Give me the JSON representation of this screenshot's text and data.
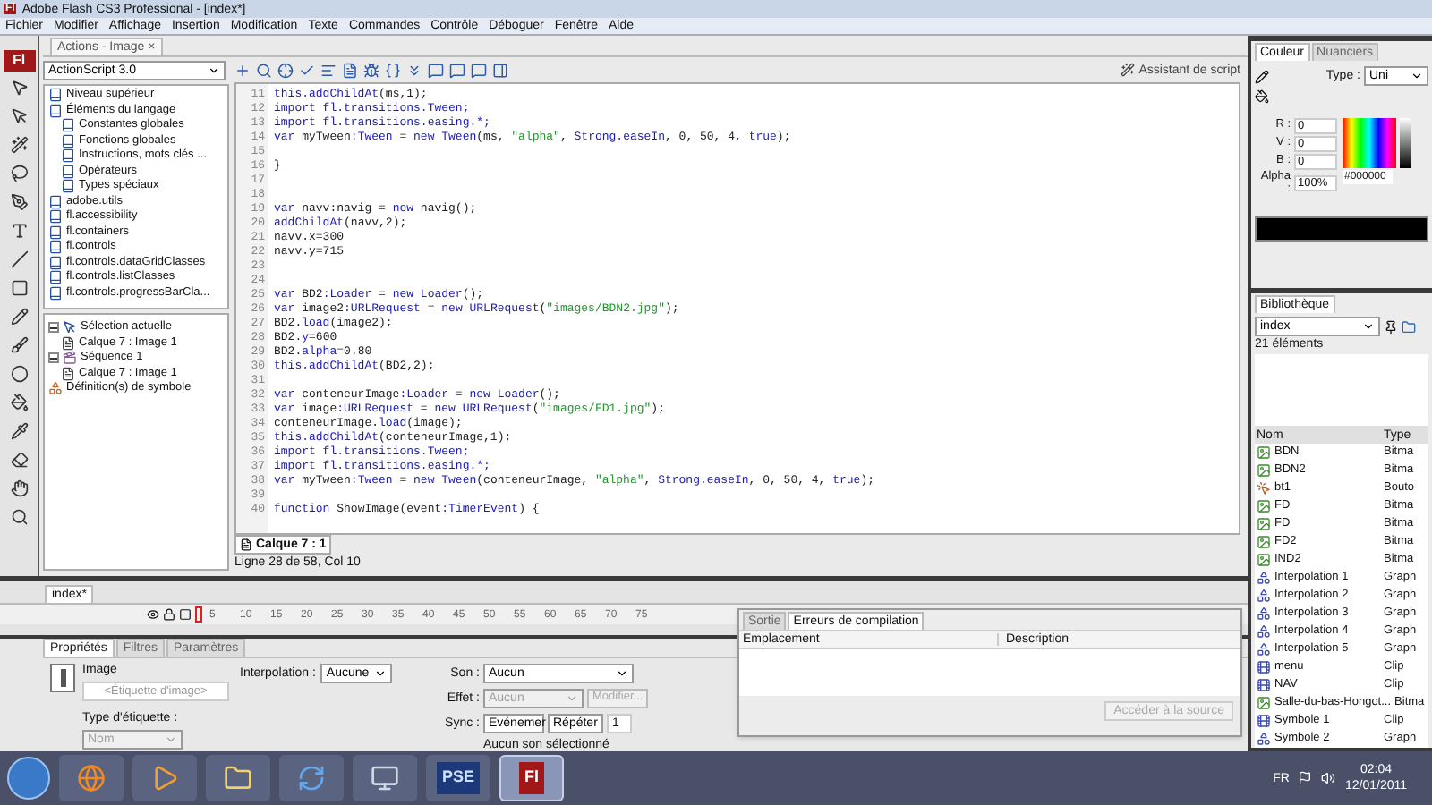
{
  "window": {
    "app_icon": "Fl",
    "title": "Adobe Flash CS3 Professional - [index*]"
  },
  "menu": [
    "Fichier",
    "Modifier",
    "Affichage",
    "Insertion",
    "Modification",
    "Texte",
    "Commandes",
    "Contrôle",
    "Déboguer",
    "Fenêtre",
    "Aide"
  ],
  "tools": {
    "logo": "Fl"
  },
  "actions_panel": {
    "tab": "Actions - Image",
    "close": "×",
    "language": "ActionScript 3.0",
    "toolbox_tree": [
      {
        "label": "Niveau supérieur",
        "kind": "book"
      },
      {
        "label": "Éléments du langage",
        "kind": "book",
        "children": [
          {
            "label": "Constantes globales",
            "kind": "book"
          },
          {
            "label": "Fonctions globales",
            "kind": "book"
          },
          {
            "label": "Instructions, mots clés ...",
            "kind": "book"
          },
          {
            "label": "Opérateurs",
            "kind": "book"
          },
          {
            "label": "Types spéciaux",
            "kind": "book"
          }
        ]
      },
      {
        "label": "adobe.utils",
        "kind": "book"
      },
      {
        "label": "fl.accessibility",
        "kind": "book"
      },
      {
        "label": "fl.containers",
        "kind": "book"
      },
      {
        "label": "fl.controls",
        "kind": "book"
      },
      {
        "label": "fl.controls.dataGridClasses",
        "kind": "book"
      },
      {
        "label": "fl.controls.listClasses",
        "kind": "book"
      },
      {
        "label": "fl.controls.progressBarCla...",
        "kind": "book"
      }
    ],
    "script_tree": [
      {
        "label": "Sélection actuelle",
        "kind": "selection",
        "expanded": true,
        "children": [
          {
            "label": "Calque 7 : Image 1",
            "kind": "layer"
          }
        ]
      },
      {
        "label": "Séquence 1",
        "kind": "scene",
        "expanded": true,
        "children": [
          {
            "label": "Calque 7 : Image 1",
            "kind": "layer"
          }
        ]
      },
      {
        "label": "Définition(s) de symbole",
        "kind": "symbols"
      }
    ],
    "assistant": "Assistant de script",
    "code_lines": [
      {
        "number": "11",
        "tokens": [
          {
            "text": "this.addChildAt",
            "kind": "kw"
          },
          {
            "text": "(ms,1);",
            "kind": "plain"
          }
        ]
      },
      {
        "number": "12",
        "tokens": [
          {
            "text": "import fl.transitions.Tween;",
            "kind": "kw"
          }
        ]
      },
      {
        "number": "13",
        "tokens": [
          {
            "text": "import fl.transitions.easing.*;",
            "kind": "kw"
          }
        ]
      },
      {
        "number": "14",
        "tokens": [
          {
            "text": "var",
            "kind": "kw"
          },
          {
            "text": " myTween",
            "kind": "plain"
          },
          {
            "text": ":Tween",
            "kind": "kw"
          },
          {
            "text": " = ",
            "kind": "plain"
          },
          {
            "text": "new Tween",
            "kind": "kw"
          },
          {
            "text": "(ms, ",
            "kind": "plain"
          },
          {
            "text": "\"alpha\"",
            "kind": "str"
          },
          {
            "text": ", ",
            "kind": "plain"
          },
          {
            "text": "Strong.easeIn",
            "kind": "kw"
          },
          {
            "text": ", 0, 50, 4, ",
            "kind": "plain"
          },
          {
            "text": "true",
            "kind": "kw"
          },
          {
            "text": ");",
            "kind": "plain"
          }
        ]
      },
      {
        "number": "15"
      },
      {
        "number": "16",
        "tokens": [
          {
            "text": "}",
            "kind": "plain"
          }
        ]
      },
      {
        "number": "17"
      },
      {
        "number": "18"
      },
      {
        "number": "19",
        "tokens": [
          {
            "text": "var",
            "kind": "kw"
          },
          {
            "text": " navv:navig = ",
            "kind": "plain"
          },
          {
            "text": "new",
            "kind": "kw"
          },
          {
            "text": " navig();",
            "kind": "plain"
          }
        ]
      },
      {
        "number": "20",
        "tokens": [
          {
            "text": "addChildAt",
            "kind": "kw"
          },
          {
            "text": "(navv,2);",
            "kind": "plain"
          }
        ]
      },
      {
        "number": "21",
        "tokens": [
          {
            "text": "navv.x=300",
            "kind": "plain"
          }
        ]
      },
      {
        "number": "22",
        "tokens": [
          {
            "text": "navv.y=715",
            "kind": "plain"
          }
        ]
      },
      {
        "number": "23"
      },
      {
        "number": "24"
      },
      {
        "number": "25",
        "tokens": [
          {
            "text": "var",
            "kind": "kw"
          },
          {
            "text": " BD2",
            "kind": "plain"
          },
          {
            "text": ":Loader",
            "kind": "kw"
          },
          {
            "text": " = ",
            "kind": "plain"
          },
          {
            "text": "new Loader",
            "kind": "kw"
          },
          {
            "text": "();",
            "kind": "plain"
          }
        ]
      },
      {
        "number": "26",
        "tokens": [
          {
            "text": "var",
            "kind": "kw"
          },
          {
            "text": " image2",
            "kind": "plain"
          },
          {
            "text": ":URLRequest",
            "kind": "kw"
          },
          {
            "text": " = ",
            "kind": "plain"
          },
          {
            "text": "new URLRequest",
            "kind": "kw"
          },
          {
            "text": "(",
            "kind": "plain"
          },
          {
            "text": "\"images/BDN2.jpg\"",
            "kind": "str"
          },
          {
            "text": ");",
            "kind": "plain"
          }
        ]
      },
      {
        "number": "27",
        "tokens": [
          {
            "text": "BD2.",
            "kind": "plain"
          },
          {
            "text": "load",
            "kind": "kw"
          },
          {
            "text": "(image2);",
            "kind": "plain"
          }
        ]
      },
      {
        "number": "28",
        "tokens": [
          {
            "text": "BD2.",
            "kind": "plain"
          },
          {
            "text": "y",
            "kind": "kw"
          },
          {
            "text": "=600",
            "kind": "plain"
          }
        ]
      },
      {
        "number": "29",
        "tokens": [
          {
            "text": "BD2.",
            "kind": "plain"
          },
          {
            "text": "alpha",
            "kind": "kw"
          },
          {
            "text": "=0.80",
            "kind": "plain"
          }
        ]
      },
      {
        "number": "30",
        "tokens": [
          {
            "text": "this.addChildAt",
            "kind": "kw"
          },
          {
            "text": "(BD2,2);",
            "kind": "plain"
          }
        ]
      },
      {
        "number": "31"
      },
      {
        "number": "32",
        "tokens": [
          {
            "text": "var",
            "kind": "kw"
          },
          {
            "text": " conteneurImage",
            "kind": "plain"
          },
          {
            "text": ":Loader",
            "kind": "kw"
          },
          {
            "text": " = ",
            "kind": "plain"
          },
          {
            "text": "new Loader",
            "kind": "kw"
          },
          {
            "text": "();",
            "kind": "plain"
          }
        ]
      },
      {
        "number": "33",
        "tokens": [
          {
            "text": "var",
            "kind": "kw"
          },
          {
            "text": " image",
            "kind": "plain"
          },
          {
            "text": ":URLRequest",
            "kind": "kw"
          },
          {
            "text": " = ",
            "kind": "plain"
          },
          {
            "text": "new URLRequest",
            "kind": "kw"
          },
          {
            "text": "(",
            "kind": "plain"
          },
          {
            "text": "\"images/FD1.jpg\"",
            "kind": "str"
          },
          {
            "text": ");",
            "kind": "plain"
          }
        ]
      },
      {
        "number": "34",
        "tokens": [
          {
            "text": "conteneurImage.",
            "kind": "plain"
          },
          {
            "text": "load",
            "kind": "kw"
          },
          {
            "text": "(image);",
            "kind": "plain"
          }
        ]
      },
      {
        "number": "35",
        "tokens": [
          {
            "text": "this.addChildAt",
            "kind": "kw"
          },
          {
            "text": "(conteneurImage,1);",
            "kind": "plain"
          }
        ]
      },
      {
        "number": "36",
        "tokens": [
          {
            "text": "import fl.transitions.Tween;",
            "kind": "kw"
          }
        ]
      },
      {
        "number": "37",
        "tokens": [
          {
            "text": "import fl.transitions.easing.*;",
            "kind": "kw"
          }
        ]
      },
      {
        "number": "38",
        "tokens": [
          {
            "text": "var",
            "kind": "kw"
          },
          {
            "text": " myTween",
            "kind": "plain"
          },
          {
            "text": ":Tween",
            "kind": "kw"
          },
          {
            "text": " = ",
            "kind": "plain"
          },
          {
            "text": "new Tween",
            "kind": "kw"
          },
          {
            "text": "(conteneurImage, ",
            "kind": "plain"
          },
          {
            "text": "\"alpha\"",
            "kind": "str"
          },
          {
            "text": ", ",
            "kind": "plain"
          },
          {
            "text": "Strong.easeIn",
            "kind": "kw"
          },
          {
            "text": ", 0, 50, 4, ",
            "kind": "plain"
          },
          {
            "text": "true",
            "kind": "kw"
          },
          {
            "text": ");",
            "kind": "plain"
          }
        ]
      },
      {
        "number": "39"
      },
      {
        "number": "40",
        "tokens": [
          {
            "text": "function",
            "kind": "kw"
          },
          {
            "text": " ShowImage(event",
            "kind": "plain"
          },
          {
            "text": ":TimerEvent",
            "kind": "kw"
          },
          {
            "text": ") {",
            "kind": "plain"
          }
        ]
      }
    ],
    "layer_tab": "Calque 7 : 1",
    "status": "Ligne 28 de 58, Col 10"
  },
  "color_panel": {
    "tabs": [
      {
        "label": "Couleur",
        "selected": true
      },
      {
        "label": "Nuanciers",
        "selected": false
      }
    ],
    "type_label": "Type :",
    "type_value": "Uni",
    "channels": [
      {
        "label": "R :",
        "value": "0"
      },
      {
        "label": "V :",
        "value": "0"
      },
      {
        "label": "B :",
        "value": "0"
      },
      {
        "label": "Alpha :",
        "value": "100%"
      }
    ],
    "hex": "#000000"
  },
  "library": {
    "tab": "Bibliothèque",
    "document": "index",
    "count": "21 éléments",
    "columns": [
      "Nom",
      "Type"
    ],
    "items": [
      {
        "name": "BDN",
        "type": "Bitma",
        "kind": "bitmap"
      },
      {
        "name": "BDN2",
        "type": "Bitma",
        "kind": "bitmap"
      },
      {
        "name": "bt1",
        "type": "Bouto",
        "kind": "button"
      },
      {
        "name": "FD",
        "type": "Bitma",
        "kind": "bitmap"
      },
      {
        "name": "FD",
        "type": "Bitma",
        "kind": "bitmap"
      },
      {
        "name": "FD2",
        "type": "Bitma",
        "kind": "bitmap"
      },
      {
        "name": "IND2",
        "type": "Bitma",
        "kind": "bitmap"
      },
      {
        "name": "Interpolation 1",
        "type": "Graph",
        "kind": "graphic"
      },
      {
        "name": "Interpolation 2",
        "type": "Graph",
        "kind": "graphic"
      },
      {
        "name": "Interpolation 3",
        "type": "Graph",
        "kind": "graphic"
      },
      {
        "name": "Interpolation 4",
        "type": "Graph",
        "kind": "graphic"
      },
      {
        "name": "Interpolation 5",
        "type": "Graph",
        "kind": "graphic"
      },
      {
        "name": "menu",
        "type": "Clip",
        "kind": "clip"
      },
      {
        "name": "NAV",
        "type": "Clip",
        "kind": "clip"
      },
      {
        "name": "Salle-du-bas-Hongot...",
        "type": "Bitma",
        "kind": "bitmap"
      },
      {
        "name": "Symbole 1",
        "type": "Clip",
        "kind": "clip"
      },
      {
        "name": "Symbole 2",
        "type": "Graph",
        "kind": "graphic"
      }
    ]
  },
  "timeline": {
    "tab": "index*",
    "frame_numbers": [
      "5",
      "10",
      "15",
      "20",
      "25",
      "30",
      "35",
      "40",
      "45",
      "50",
      "55",
      "60",
      "65",
      "70",
      "75"
    ]
  },
  "properties": {
    "tabs": [
      {
        "label": "Propriétés",
        "selected": true
      },
      {
        "label": "Filtres",
        "selected": false
      },
      {
        "label": "Paramètres",
        "selected": false
      }
    ],
    "frame_label": "Image",
    "frame_name": {
      "placeholder": "<Étiquette d'image>"
    },
    "label_type_label": "Type d'étiquette :",
    "label_type": {
      "value": "Nom",
      "disabled": true
    },
    "tween_label": "Interpolation :",
    "tween": {
      "value": "Aucune",
      "disabled": false
    },
    "sound_label": "Son :",
    "sound": {
      "value": "Aucun",
      "disabled": false
    },
    "effect_label": "Effet :",
    "effect": {
      "value": "Aucun",
      "disabled": true
    },
    "edit_button": {
      "label": "Modifier...",
      "disabled": true
    },
    "sync_label": "Sync :",
    "sync": {
      "value": "Evénemer",
      "disabled": false
    },
    "repeat": {
      "value": "Répéter",
      "disabled": false
    },
    "repeat_count": "1",
    "sound_status": "Aucun son sélectionné"
  },
  "compile_panel": {
    "tabs": [
      {
        "label": "Sortie",
        "selected": false
      },
      {
        "label": "Erreurs de compilation",
        "selected": true
      }
    ],
    "columns": [
      "Emplacement",
      "Description"
    ],
    "button": {
      "label": "Accéder à la source",
      "disabled": true
    }
  },
  "taskbar": {
    "apps": [
      {
        "kind": "browser",
        "selected": false
      },
      {
        "kind": "media",
        "selected": false
      },
      {
        "kind": "folder",
        "selected": false
      },
      {
        "kind": "sync",
        "selected": false
      },
      {
        "kind": "network",
        "selected": false
      },
      {
        "kind": "label",
        "label": "PSE",
        "selected": false
      },
      {
        "kind": "label",
        "label": "Fl",
        "selected": true
      }
    ],
    "language": "FR",
    "time": "02:04",
    "date": "12/01/2011"
  }
}
